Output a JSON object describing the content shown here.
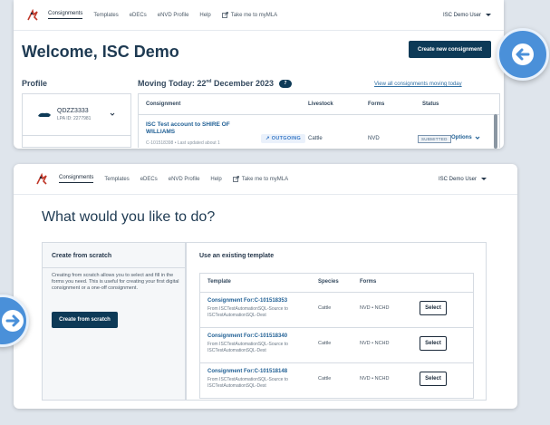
{
  "nav": {
    "items": [
      "Consignments",
      "Templates",
      "eDECs",
      "eNVD Profile",
      "Help"
    ],
    "external_link": "Take me to myMLA",
    "user": "ISC Demo User"
  },
  "top": {
    "welcome": "Welcome, ISC Demo",
    "create_btn": "Create new consignment",
    "profile_label": "Profile",
    "moving_prefix": "Moving Today: 22",
    "moving_sup": "nd",
    "moving_suffix": " December 2023",
    "moving_count": "7",
    "view_all": "View all consignments moving today",
    "profile": {
      "name": "QDZZ3333",
      "lpa": "LPA ID: 2277981"
    },
    "table_headers": {
      "consignment": "Consignment",
      "livestock": "Livestock",
      "forms": "Forms",
      "status": "Status"
    },
    "row": {
      "title": "ISC Test account to SHIRE OF WILLIAMS",
      "sub": "C-101518398 • Last updated about 1",
      "direction": "OUTGOING",
      "livestock": "Cattle",
      "forms": "NVD",
      "status": "SUBMITTED",
      "options": "Options"
    }
  },
  "bottom": {
    "heading": "What would you like to do?",
    "scratch": {
      "title": "Create from scratch",
      "desc": "Creating from scratch allows you to select and fill in the forms you need. This is useful for creating your first digital consignment or a one-off consignment.",
      "button": "Create from scratch"
    },
    "template": {
      "title": "Use an existing template",
      "headers": {
        "template": "Template",
        "species": "Species",
        "forms": "Forms"
      },
      "rows": [
        {
          "title": "Consignment For:C-101518353",
          "sub": "From ISCTestAutomationSQL-Source to ISCTestAutomationSQL-Dest",
          "species": "Cattle",
          "forms": "NVD • NCHD",
          "select": "Select"
        },
        {
          "title": "Consignment For:C-101518340",
          "sub": "From ISCTestAutomationSQL-Source to ISCTestAutomationSQL-Dest",
          "species": "Cattle",
          "forms": "NVD • NCHD",
          "select": "Select"
        },
        {
          "title": "Consignment For:C-101518148",
          "sub": "From ISCTestAutomationSQL-Source to ISCTestAutomationSQL-Dest",
          "species": "Cattle",
          "forms": "NVD • NCHD",
          "select": "Select"
        }
      ]
    }
  },
  "colors": {
    "primary": "#0d3a57",
    "accent": "#4a90d9",
    "link": "#1f5f94",
    "outgoing": "#3a7ac7"
  },
  "icons": [
    "logo-icon",
    "external-link-icon",
    "chevron-down-icon",
    "cattle-icon",
    "arrow-left-icon",
    "arrow-right-icon",
    "arrow-outgoing-icon"
  ]
}
